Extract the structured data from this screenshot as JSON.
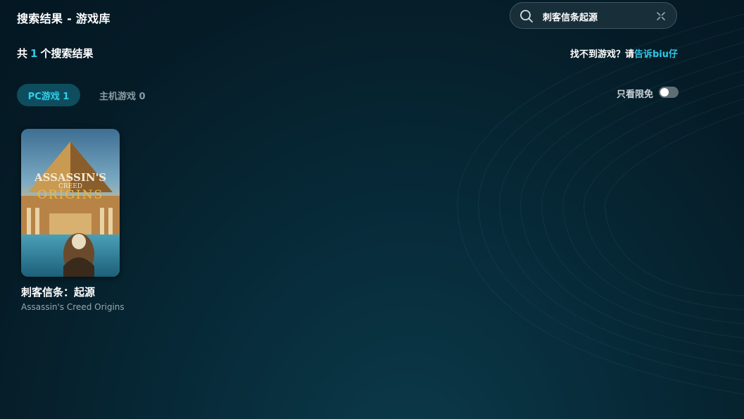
{
  "header": {
    "title": "搜索结果 - 游戏库"
  },
  "search": {
    "query": "刺客信条起源"
  },
  "results": {
    "prefix": "共",
    "count": "1",
    "suffix": "个搜索结果"
  },
  "feedback": {
    "text": "找不到游戏？请",
    "link": "告诉biu仔"
  },
  "tabs": [
    {
      "label": "PC游戏 1",
      "active": true
    },
    {
      "label": "主机游戏 0",
      "active": false
    }
  ],
  "filter": {
    "free_only_label": "只看限免",
    "free_only_on": false
  },
  "games": [
    {
      "name_cn": "刺客信条：起源",
      "name_en": "Assassin's Creed Origins",
      "cover_logo_line1": "ASSASSIN'S",
      "cover_logo_line2": "CREED",
      "cover_logo_line3": "ORIGINS"
    }
  ],
  "colors": {
    "accent": "#2fc6e8",
    "tab_active_bg": "#0e4d5d",
    "bg": "#051c27"
  }
}
